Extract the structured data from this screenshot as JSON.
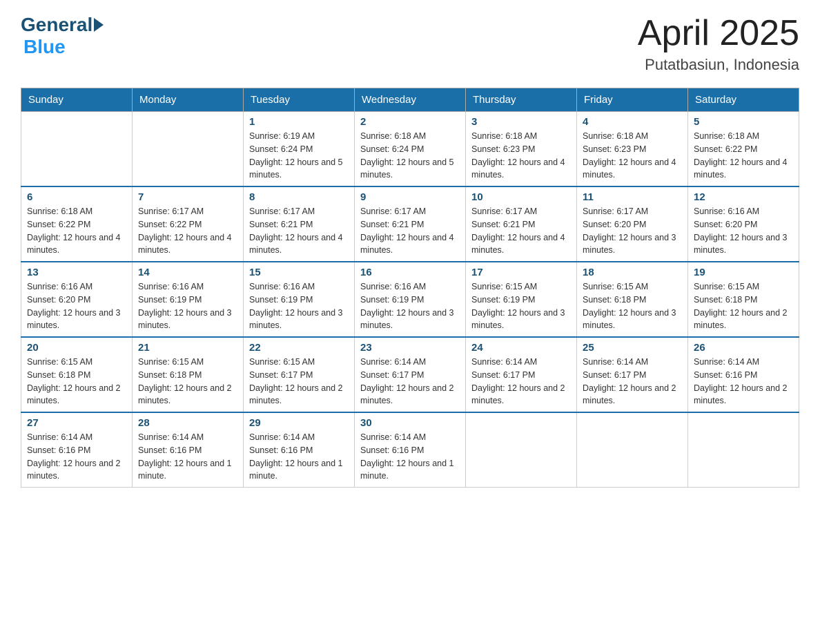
{
  "header": {
    "logo": {
      "general": "General",
      "blue": "Blue"
    },
    "title": "April 2025",
    "location": "Putatbasiun, Indonesia"
  },
  "days_of_week": [
    "Sunday",
    "Monday",
    "Tuesday",
    "Wednesday",
    "Thursday",
    "Friday",
    "Saturday"
  ],
  "weeks": [
    [
      {
        "day": "",
        "sunrise": "",
        "sunset": "",
        "daylight": ""
      },
      {
        "day": "",
        "sunrise": "",
        "sunset": "",
        "daylight": ""
      },
      {
        "day": "1",
        "sunrise": "Sunrise: 6:19 AM",
        "sunset": "Sunset: 6:24 PM",
        "daylight": "Daylight: 12 hours and 5 minutes."
      },
      {
        "day": "2",
        "sunrise": "Sunrise: 6:18 AM",
        "sunset": "Sunset: 6:24 PM",
        "daylight": "Daylight: 12 hours and 5 minutes."
      },
      {
        "day": "3",
        "sunrise": "Sunrise: 6:18 AM",
        "sunset": "Sunset: 6:23 PM",
        "daylight": "Daylight: 12 hours and 4 minutes."
      },
      {
        "day": "4",
        "sunrise": "Sunrise: 6:18 AM",
        "sunset": "Sunset: 6:23 PM",
        "daylight": "Daylight: 12 hours and 4 minutes."
      },
      {
        "day": "5",
        "sunrise": "Sunrise: 6:18 AM",
        "sunset": "Sunset: 6:22 PM",
        "daylight": "Daylight: 12 hours and 4 minutes."
      }
    ],
    [
      {
        "day": "6",
        "sunrise": "Sunrise: 6:18 AM",
        "sunset": "Sunset: 6:22 PM",
        "daylight": "Daylight: 12 hours and 4 minutes."
      },
      {
        "day": "7",
        "sunrise": "Sunrise: 6:17 AM",
        "sunset": "Sunset: 6:22 PM",
        "daylight": "Daylight: 12 hours and 4 minutes."
      },
      {
        "day": "8",
        "sunrise": "Sunrise: 6:17 AM",
        "sunset": "Sunset: 6:21 PM",
        "daylight": "Daylight: 12 hours and 4 minutes."
      },
      {
        "day": "9",
        "sunrise": "Sunrise: 6:17 AM",
        "sunset": "Sunset: 6:21 PM",
        "daylight": "Daylight: 12 hours and 4 minutes."
      },
      {
        "day": "10",
        "sunrise": "Sunrise: 6:17 AM",
        "sunset": "Sunset: 6:21 PM",
        "daylight": "Daylight: 12 hours and 4 minutes."
      },
      {
        "day": "11",
        "sunrise": "Sunrise: 6:17 AM",
        "sunset": "Sunset: 6:20 PM",
        "daylight": "Daylight: 12 hours and 3 minutes."
      },
      {
        "day": "12",
        "sunrise": "Sunrise: 6:16 AM",
        "sunset": "Sunset: 6:20 PM",
        "daylight": "Daylight: 12 hours and 3 minutes."
      }
    ],
    [
      {
        "day": "13",
        "sunrise": "Sunrise: 6:16 AM",
        "sunset": "Sunset: 6:20 PM",
        "daylight": "Daylight: 12 hours and 3 minutes."
      },
      {
        "day": "14",
        "sunrise": "Sunrise: 6:16 AM",
        "sunset": "Sunset: 6:19 PM",
        "daylight": "Daylight: 12 hours and 3 minutes."
      },
      {
        "day": "15",
        "sunrise": "Sunrise: 6:16 AM",
        "sunset": "Sunset: 6:19 PM",
        "daylight": "Daylight: 12 hours and 3 minutes."
      },
      {
        "day": "16",
        "sunrise": "Sunrise: 6:16 AM",
        "sunset": "Sunset: 6:19 PM",
        "daylight": "Daylight: 12 hours and 3 minutes."
      },
      {
        "day": "17",
        "sunrise": "Sunrise: 6:15 AM",
        "sunset": "Sunset: 6:19 PM",
        "daylight": "Daylight: 12 hours and 3 minutes."
      },
      {
        "day": "18",
        "sunrise": "Sunrise: 6:15 AM",
        "sunset": "Sunset: 6:18 PM",
        "daylight": "Daylight: 12 hours and 3 minutes."
      },
      {
        "day": "19",
        "sunrise": "Sunrise: 6:15 AM",
        "sunset": "Sunset: 6:18 PM",
        "daylight": "Daylight: 12 hours and 2 minutes."
      }
    ],
    [
      {
        "day": "20",
        "sunrise": "Sunrise: 6:15 AM",
        "sunset": "Sunset: 6:18 PM",
        "daylight": "Daylight: 12 hours and 2 minutes."
      },
      {
        "day": "21",
        "sunrise": "Sunrise: 6:15 AM",
        "sunset": "Sunset: 6:18 PM",
        "daylight": "Daylight: 12 hours and 2 minutes."
      },
      {
        "day": "22",
        "sunrise": "Sunrise: 6:15 AM",
        "sunset": "Sunset: 6:17 PM",
        "daylight": "Daylight: 12 hours and 2 minutes."
      },
      {
        "day": "23",
        "sunrise": "Sunrise: 6:14 AM",
        "sunset": "Sunset: 6:17 PM",
        "daylight": "Daylight: 12 hours and 2 minutes."
      },
      {
        "day": "24",
        "sunrise": "Sunrise: 6:14 AM",
        "sunset": "Sunset: 6:17 PM",
        "daylight": "Daylight: 12 hours and 2 minutes."
      },
      {
        "day": "25",
        "sunrise": "Sunrise: 6:14 AM",
        "sunset": "Sunset: 6:17 PM",
        "daylight": "Daylight: 12 hours and 2 minutes."
      },
      {
        "day": "26",
        "sunrise": "Sunrise: 6:14 AM",
        "sunset": "Sunset: 6:16 PM",
        "daylight": "Daylight: 12 hours and 2 minutes."
      }
    ],
    [
      {
        "day": "27",
        "sunrise": "Sunrise: 6:14 AM",
        "sunset": "Sunset: 6:16 PM",
        "daylight": "Daylight: 12 hours and 2 minutes."
      },
      {
        "day": "28",
        "sunrise": "Sunrise: 6:14 AM",
        "sunset": "Sunset: 6:16 PM",
        "daylight": "Daylight: 12 hours and 1 minute."
      },
      {
        "day": "29",
        "sunrise": "Sunrise: 6:14 AM",
        "sunset": "Sunset: 6:16 PM",
        "daylight": "Daylight: 12 hours and 1 minute."
      },
      {
        "day": "30",
        "sunrise": "Sunrise: 6:14 AM",
        "sunset": "Sunset: 6:16 PM",
        "daylight": "Daylight: 12 hours and 1 minute."
      },
      {
        "day": "",
        "sunrise": "",
        "sunset": "",
        "daylight": ""
      },
      {
        "day": "",
        "sunrise": "",
        "sunset": "",
        "daylight": ""
      },
      {
        "day": "",
        "sunrise": "",
        "sunset": "",
        "daylight": ""
      }
    ]
  ]
}
